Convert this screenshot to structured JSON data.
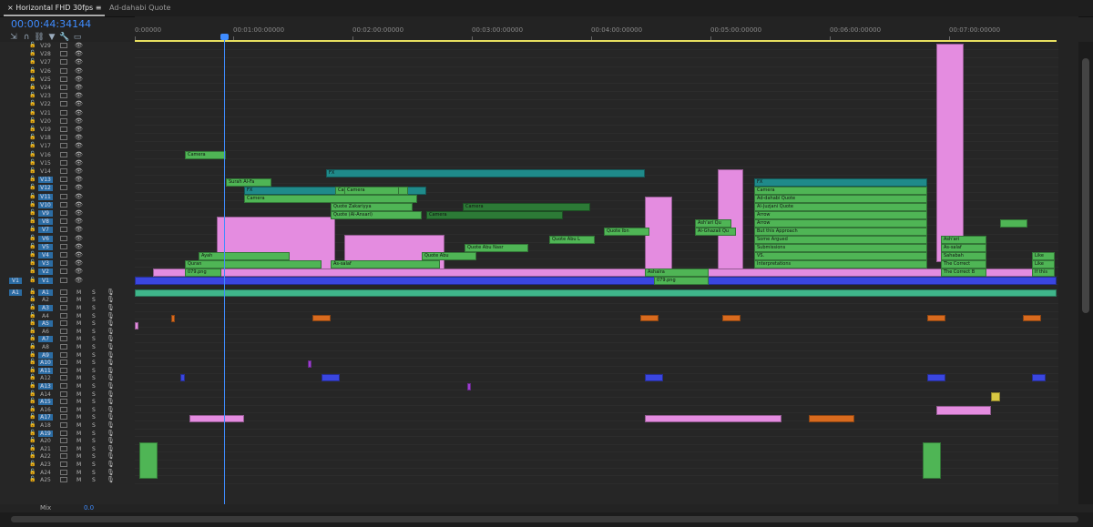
{
  "tabs": [
    {
      "label": "Horizontal FHD 30fps",
      "active": true
    },
    {
      "label": "Ad-dahabi Quote",
      "active": false
    }
  ],
  "timecode": "00:00:44:34144",
  "ruler_labels": [
    "0:00000",
    "00:01:00:00000",
    "00:02:00:00000",
    "00:03:00:00000",
    "00:04:00:00000",
    "00:05:00:00000",
    "00:06:00:00000",
    "00:07:00:00000"
  ],
  "video_tracks": [
    "V29",
    "V28",
    "V27",
    "V26",
    "V25",
    "V24",
    "V23",
    "V22",
    "V21",
    "V20",
    "V19",
    "V18",
    "V17",
    "V16",
    "V15",
    "V14",
    "V13",
    "V12",
    "V11",
    "V10",
    "V9",
    "V8",
    "V7",
    "V6",
    "V5",
    "V4",
    "V3",
    "V2",
    "V1"
  ],
  "audio_tracks": [
    "A1",
    "A2",
    "A3",
    "A4",
    "A5",
    "A6",
    "A7",
    "A8",
    "A9",
    "A10",
    "A11",
    "A12",
    "A13",
    "A14",
    "A15",
    "A16",
    "A17",
    "A18",
    "A19",
    "A20",
    "A21",
    "A22",
    "A23",
    "A24",
    "A25"
  ],
  "source_patch": {
    "video": "V1",
    "audio": "A1"
  },
  "mix": {
    "label": "Mix",
    "value": "0.0"
  },
  "clip_labels": {
    "fx": "FX",
    "camera": "Camera",
    "surah": "Surah Al-Fa",
    "quote_zak": "Quote Zakariyya",
    "quote_ansari": "Quote (Al-Ansari)",
    "quote_nasr": "Quote Abu Nasr",
    "quote_abu": "Quote Abu",
    "quote_abu_l": "Quote Abu L",
    "quote_ibn": "Quote Ibn",
    "ayah": "Ayah",
    "quran": "Quran",
    "png079": "079.png",
    "assalaf": "As-salaf",
    "ashaira": "Ashaira",
    "addahabi": "Ad-dahabi Quote",
    "aljuzjani": "Al-Juzjani Quote",
    "arrow": "Arrow",
    "butthis": "But this Approach",
    "some": "Some Argued",
    "submissions": "Submissions",
    "vs": "VS.",
    "interp": "Interpretations",
    "ashari": "Ash'ari",
    "assalaf2": "As-salaf",
    "sahabah": "Sahabah",
    "correct": "The Correct",
    "correct_b": "The Correct B",
    "like": "Like",
    "ifthis": "If this",
    "ashari_qu": "Ash'ari Qu",
    "ghazali": "Al-Ghazali Qu"
  },
  "colors": {
    "accent": "#3f8cff",
    "clip_pink": "#e48ce0",
    "clip_green": "#4fb555",
    "clip_teal": "#1f8a8a",
    "clip_blue": "#3a46e0",
    "audio_green": "#3fb58a",
    "work_area": "#e8e060"
  }
}
